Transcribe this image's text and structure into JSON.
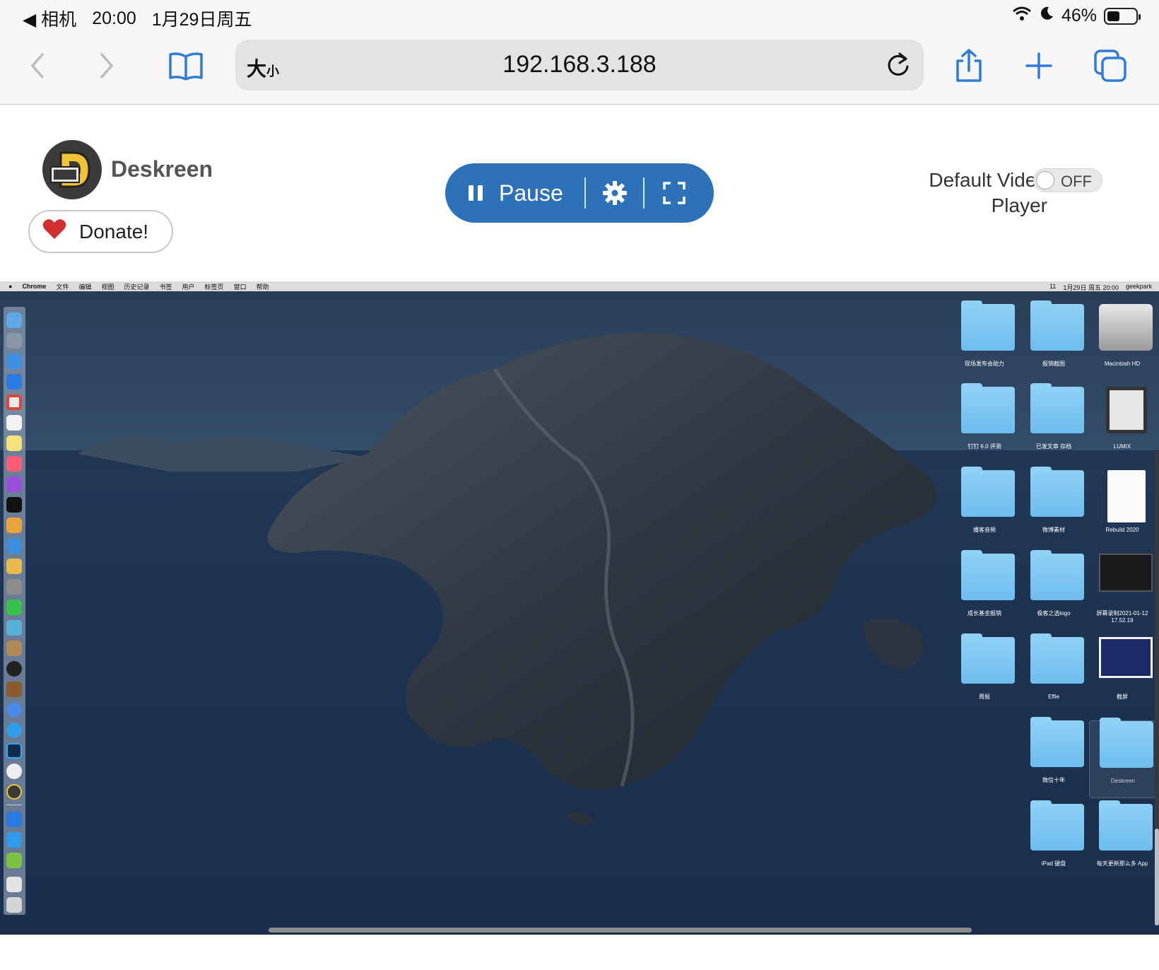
{
  "statusbar": {
    "back_app": "◀ 相机",
    "time": "20:00",
    "date": "1月29日周五",
    "battery": "46%",
    "battery_level": 0.46
  },
  "toolbar": {
    "reader_big": "大",
    "reader_small": "小",
    "url": "192.168.3.188"
  },
  "header": {
    "brand": "Deskreen",
    "donate_label": "Donate!",
    "pause_label": "Pause",
    "default_video_player_label": "Default Video Player",
    "toggle_label": "OFF"
  },
  "shared_screen": {
    "menubar": {
      "app": "Chrome",
      "items": [
        "文件",
        "编辑",
        "视图",
        "历史记录",
        "书签",
        "用户",
        "标签页",
        "窗口",
        "帮助"
      ],
      "right_text": [
        "11",
        "1月29日 周五 20:00",
        "geekpark"
      ]
    },
    "desktop_items": [
      {
        "name": "现场发布会助力",
        "kind": "folder"
      },
      {
        "name": "报销截图",
        "kind": "folder"
      },
      {
        "name": "Macintosh HD",
        "kind": "drive"
      },
      {
        "name": "钉钉 6.0 评测",
        "kind": "folder"
      },
      {
        "name": "已发文章 存档",
        "kind": "folder"
      },
      {
        "name": "LUMIX",
        "kind": "sdcard"
      },
      {
        "name": "播客音频",
        "kind": "folder"
      },
      {
        "name": "微博素材",
        "kind": "folder"
      },
      {
        "name": "Rebuild 2020",
        "kind": "document"
      },
      {
        "name": "成长基金报销",
        "kind": "folder"
      },
      {
        "name": "极客之选logo",
        "kind": "folder"
      },
      {
        "name": "屏幕录制2021-01-12 17.52.19",
        "kind": "video"
      },
      {
        "name": "周报",
        "kind": "folder"
      },
      {
        "name": "Effie",
        "kind": "folder"
      },
      {
        "name": "截屏",
        "kind": "image"
      },
      {
        "name": "微信十年",
        "kind": "folder"
      },
      {
        "name": "Deskreen",
        "kind": "folder"
      },
      {
        "name": "iPad 键盘",
        "kind": "folder"
      },
      {
        "name": "每天更新那么多 App",
        "kind": "folder"
      }
    ],
    "colors": {
      "accent": "#2d71b8",
      "folder": "#7cc6f1",
      "sea": "#1c2c44"
    }
  }
}
